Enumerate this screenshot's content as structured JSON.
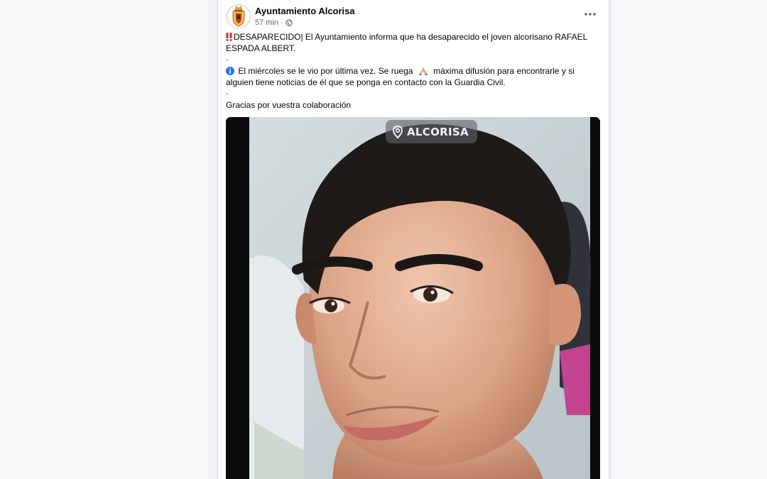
{
  "post": {
    "author": "Ayuntamiento Alcorisa",
    "time": "57 min",
    "separator": "·",
    "more_icon": "more-horizontal-icon",
    "audience_icon": "globe-icon",
    "paragraphs": {
      "p1": "DESAPARECIDO| El Ayuntamiento informa que ha desaparecido el joven alcorisano RAFAEL ESPADA ALBERT.",
      "dot1": ".",
      "p2_a": "El miércoles se le vio por última vez. Se ruega",
      "p2_b": "máxima difusión para encontrarle y si alguien tiene noticias de él que se ponga en contacto con la Guardia Civil.",
      "dot2": ".",
      "p3": "Gracias por vuestra colaboración"
    },
    "emoji_icons": [
      "double-exclamation-icon",
      "info-icon",
      "praying-hands-icon"
    ],
    "photo": {
      "location_label": "ALCORISA",
      "location_icon": "map-pin-icon"
    }
  },
  "colors": {
    "accent_red": "#e4252c",
    "info_blue": "#1877f2",
    "muted_text": "#65676b"
  }
}
